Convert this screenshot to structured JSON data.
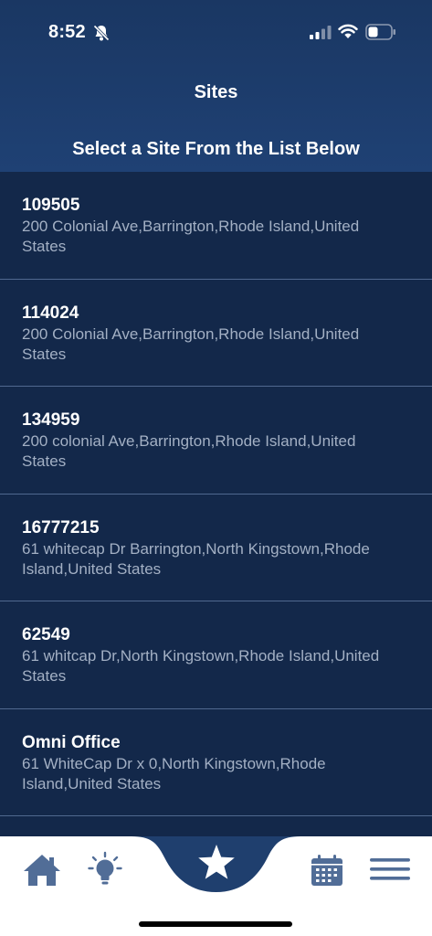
{
  "status_bar": {
    "time": "8:52",
    "icons": [
      "bell-slash-icon",
      "signal-icon",
      "wifi-icon",
      "battery-icon"
    ]
  },
  "header": {
    "title": "Sites",
    "subtitle": "Select a Site From the List Below"
  },
  "sites": [
    {
      "id": "109505",
      "address": "200 Colonial Ave,Barrington,Rhode Island,United States"
    },
    {
      "id": "114024",
      "address": "200 Colonial Ave,Barrington,Rhode Island,United States"
    },
    {
      "id": "134959",
      "address": "200 colonial Ave,Barrington,Rhode Island,United States"
    },
    {
      "id": "16777215",
      "address": "61 whitecap Dr Barrington,North Kingstown,Rhode Island,United States"
    },
    {
      "id": "62549",
      "address": "61 whitcap Dr,North Kingstown,Rhode Island,United States"
    },
    {
      "id": "Omni Office",
      "address": "61 WhiteCap Dr x 0,North Kingstown,Rhode Island,United States"
    }
  ],
  "tab_bar": {
    "tabs": [
      "home-icon",
      "lightbulb-icon",
      "star-icon",
      "calendar-icon",
      "menu-icon"
    ],
    "active": "star-icon"
  },
  "colors": {
    "header": "#1f4174",
    "list_background": "#13284a",
    "accent": "#1f3f6e",
    "icon": "#516d97",
    "address_text": "#a3b0c4"
  }
}
